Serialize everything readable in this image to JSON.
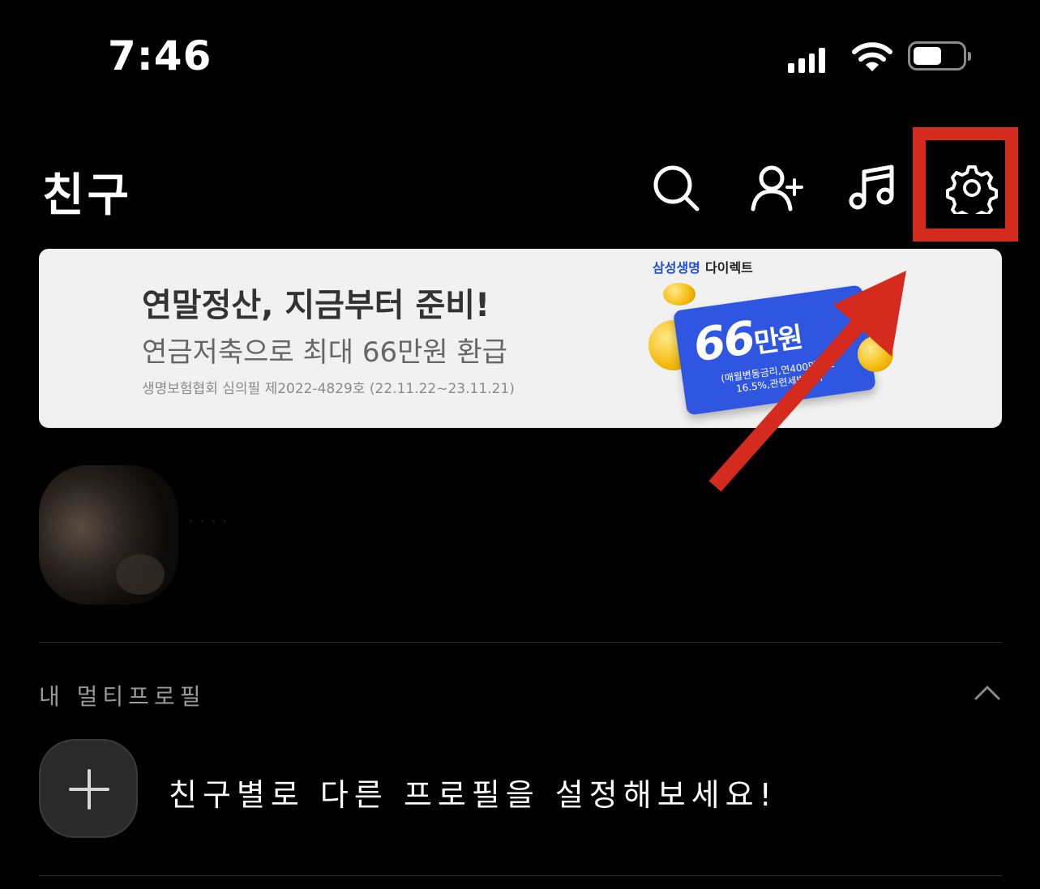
{
  "status_bar": {
    "time": "7:46",
    "signal_icon": "cellular-signal-icon",
    "wifi_icon": "wifi-icon",
    "battery_icon": "battery-icon"
  },
  "header": {
    "title": "친구",
    "icons": [
      "search-icon",
      "add-friend-icon",
      "music-icon",
      "settings-icon"
    ]
  },
  "banner": {
    "headline": "연말정산, 지금부터 준비!",
    "subline": "연금저축으로 최대 66만원 환급",
    "note": "생명보험협회 심의필 제2022-4829호 (22.11.22~23.11.21)",
    "brand_primary": "삼성생명",
    "brand_secondary": "다이렉트",
    "ticket_amount": "66",
    "ticket_unit": "만원",
    "ticket_detail_1": "(매월변동금리,연400만원한",
    "ticket_detail_2": "16.5%,관련세법충족"
  },
  "profile": {
    "name": "· · · ·"
  },
  "multi_profile": {
    "section_label": "내 멀티프로필",
    "prompt": "친구별로 다른 프로필을 설정해보세요!"
  },
  "annotation": {
    "highlight_color": "#d52b1e",
    "arrow_color": "#d52b1e"
  }
}
